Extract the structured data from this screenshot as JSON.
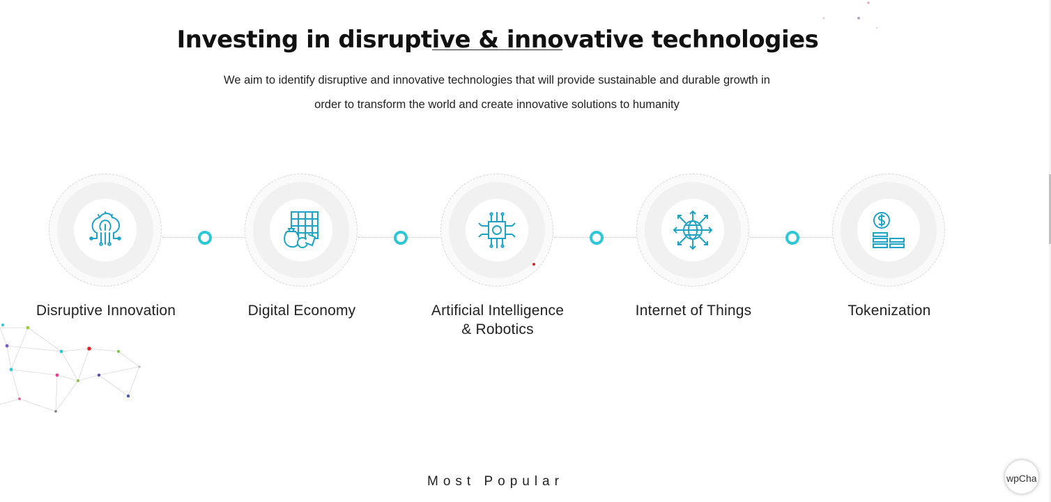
{
  "section": {
    "title": "Investing in disruptive & innovative technologies",
    "intro_line1": "We aim to identify disruptive and innovative technologies that will provide sustainable and durable growth in",
    "intro_line2": "order to transform the world and create innovative solutions to humanity"
  },
  "technologies": [
    {
      "label": "Disruptive Innovation",
      "icon": "brain-circuit-icon"
    },
    {
      "label": "Digital Economy",
      "icon": "money-grid-icon"
    },
    {
      "label_line1": "Artificial Intelligence",
      "label_line2": "& Robotics",
      "icon": "chip-circuit-icon"
    },
    {
      "label": "Internet of Things",
      "icon": "globe-arrows-icon"
    },
    {
      "label": "Tokenization",
      "icon": "coin-stack-icon"
    }
  ],
  "most_popular": "Most Popular",
  "chat_widget": {
    "alt": "wpCha"
  },
  "colors": {
    "accent": "#2ec7d6",
    "icon": "#1fa3c4",
    "text": "#222222"
  }
}
